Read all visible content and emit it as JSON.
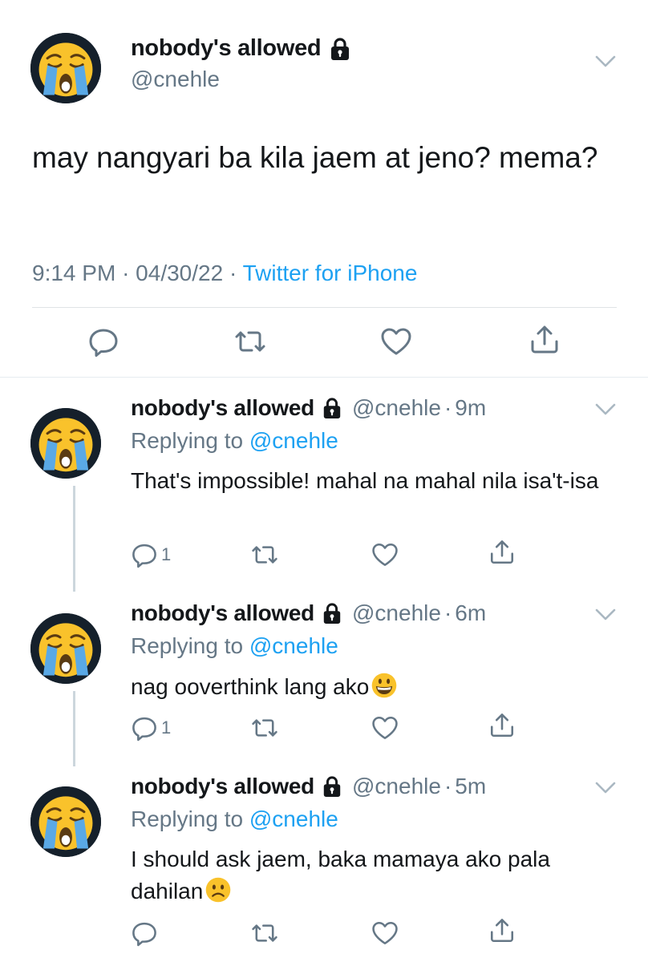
{
  "main_tweet": {
    "display_name": "nobody's allowed",
    "handle": "@cnehle",
    "text": "may nangyari ba kila jaem at jeno? mema?",
    "time": "9:14 PM",
    "date": "04/30/22",
    "dot": "·",
    "source": "Twitter for iPhone"
  },
  "replies": [
    {
      "display_name": "nobody's allowed",
      "handle": "@cnehle",
      "age": "9m",
      "replying_prefix": "Replying to",
      "replying_to": "@cnehle",
      "text": "That's impossible! mahal na mahal nila isa't-isa",
      "reply_count": "1",
      "emoji": null
    },
    {
      "display_name": "nobody's allowed",
      "handle": "@cnehle",
      "age": "6m",
      "replying_prefix": "Replying to",
      "replying_to": "@cnehle",
      "text": "nag ooverthink lang ako",
      "reply_count": "1",
      "emoji": "grinning-face"
    },
    {
      "display_name": "nobody's allowed",
      "handle": "@cnehle",
      "age": "5m",
      "replying_prefix": "Replying to",
      "replying_to": "@cnehle",
      "text": "I should ask jaem, baka mamaya ako pala dahilan",
      "reply_count": "",
      "emoji": "frowning-face"
    }
  ],
  "colors": {
    "link": "#1da1f2",
    "secondary_text": "#657786",
    "icon": "#657786"
  }
}
